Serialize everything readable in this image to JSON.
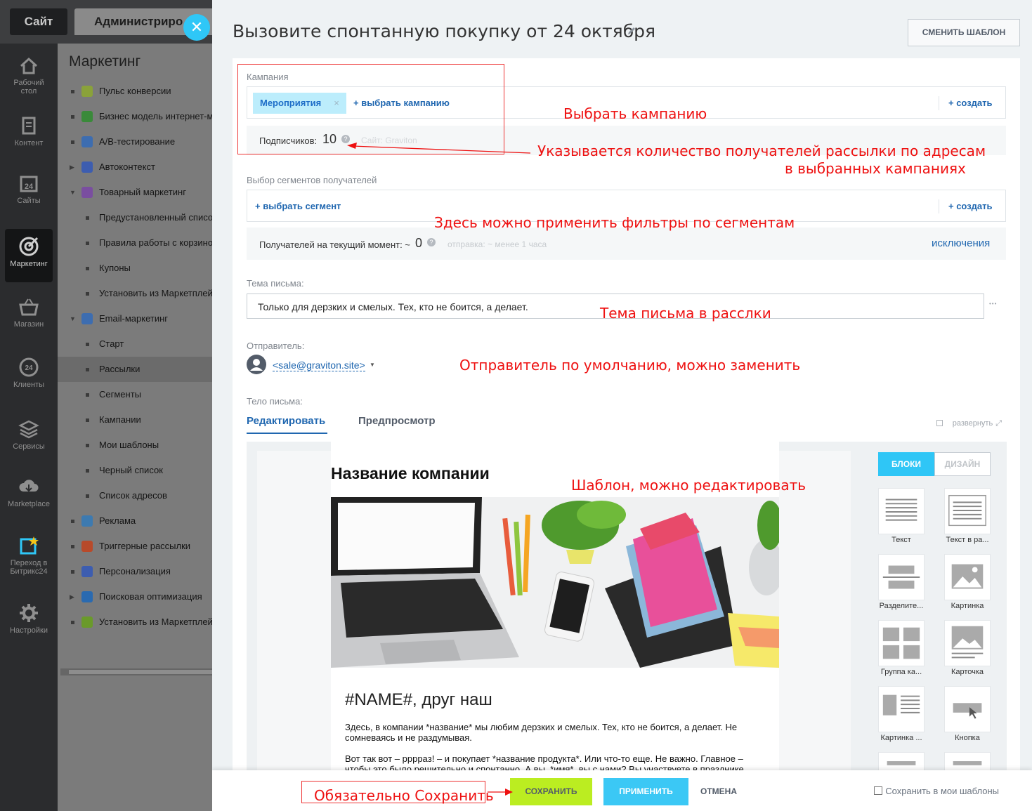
{
  "topbar": {
    "site_tab": "Сайт",
    "admin_tab": "Администриро",
    "close_glyph": "✕"
  },
  "leftbar": [
    {
      "label": "Рабочий стол",
      "icon": "home-icon"
    },
    {
      "label": "Контент",
      "icon": "document-icon"
    },
    {
      "label": "Сайты",
      "icon": "calendar-24-icon"
    },
    {
      "label": "Маркетинг",
      "icon": "target-icon"
    },
    {
      "label": "Магазин",
      "icon": "basket-icon"
    },
    {
      "label": "Клиенты",
      "icon": "clients-24-icon"
    },
    {
      "label": "Сервисы",
      "icon": "layers-icon"
    },
    {
      "label": "Marketplace",
      "icon": "cloud-download-icon"
    },
    {
      "label": "Переход в Битрикс24",
      "icon": "bitrix24-icon"
    },
    {
      "label": "Настройки",
      "icon": "gear-icon"
    }
  ],
  "menu": {
    "title": "Маркетинг",
    "items": [
      {
        "label": "Пульс конверсии",
        "icon": "funnel-icon",
        "type": "top"
      },
      {
        "label": "Бизнес модель интернет-м",
        "icon": "business-model-icon",
        "type": "top"
      },
      {
        "label": "A/B-тестирование",
        "icon": "ab-test-icon",
        "type": "top"
      },
      {
        "label": "Автоконтекст",
        "icon": "autocontext-icon",
        "type": "collapsed"
      },
      {
        "label": "Товарный маркетинг",
        "icon": "percent-icon",
        "type": "expanded"
      },
      {
        "label": "Предустановленный списо",
        "type": "sub"
      },
      {
        "label": "Правила работы с корзино",
        "type": "sub"
      },
      {
        "label": "Купоны",
        "type": "sub"
      },
      {
        "label": "Установить из Маркетплей",
        "type": "sub"
      },
      {
        "label": "Email-маркетинг",
        "icon": "email-marketing-icon",
        "type": "expanded"
      },
      {
        "label": "Старт",
        "type": "sub"
      },
      {
        "label": "Рассылки",
        "type": "sub",
        "selected": true
      },
      {
        "label": "Сегменты",
        "type": "sub"
      },
      {
        "label": "Кампании",
        "type": "sub"
      },
      {
        "label": "Мои шаблоны",
        "type": "sub"
      },
      {
        "label": "Черный список",
        "type": "sub"
      },
      {
        "label": "Список адресов",
        "type": "sub"
      },
      {
        "label": "Реклама",
        "icon": "megaphone-icon",
        "type": "top"
      },
      {
        "label": "Триггерные рассылки",
        "icon": "trigger-icon",
        "type": "top"
      },
      {
        "label": "Персонализация",
        "icon": "person-icon",
        "type": "top"
      },
      {
        "label": "Поисковая оптимизация",
        "icon": "seo-icon",
        "type": "collapsed"
      },
      {
        "label": "Установить из Маркетплей",
        "icon": "cart-icon",
        "type": "top"
      }
    ]
  },
  "header": {
    "title": "Вызовите спонтанную покупку от 24 октября",
    "change_template": "СМЕНИТЬ ШАБЛОН"
  },
  "campaign": {
    "label": "Кампания",
    "tag": "Мероприятия",
    "tag_remove": "×",
    "choose": "+ выбрать кампанию",
    "create": "+ создать",
    "subscribers_label": "Подписчиков:",
    "subscribers_count": "10",
    "site": "Сайт: Graviton"
  },
  "segments": {
    "label": "Выбор сегментов получателей",
    "choose": "+ выбрать сегмент",
    "create": "+ создать",
    "recipients_label": "Получателей на текущий момент: ~",
    "recipients_count": "0",
    "send_time": "отправка: ~ менее 1 часа",
    "exclusions": "исключения"
  },
  "subject": {
    "label": "Тема письма:",
    "value": "Только для дерзких и смелых. Тех, кто не боится, а делает.",
    "more": "•••"
  },
  "sender": {
    "label": "Отправитель:",
    "email": "<sale@graviton.site>"
  },
  "body": {
    "label": "Тело письма:",
    "tab_edit": "Редактировать",
    "tab_preview": "Предпросмотр",
    "expand": "развернуть"
  },
  "email": {
    "company": "Название компании",
    "greeting": "#NAME#, друг наш",
    "para1": "Здесь, в компании *название* мы любим дерзких и смелых. Тех, кто не боится, а делает. Не сомневаясь и не раздумывая.",
    "para2": "Вот так вот – ррррaз! – и покупает *название продукта*. Или что-то еще. Не важно. Главное – чтобы это было решительно и спонтанно. А вы, *имя*, вы с нами? Вы участвуете в празднике"
  },
  "blocks_panel": {
    "tab_blocks": "БЛОКИ",
    "tab_design": "ДИЗАЙН",
    "blocks": [
      "Текст",
      "Текст в ра...",
      "Разделите...",
      "Картинка",
      "Группа ка...",
      "Карточка",
      "Картинка ...",
      "Кнопка"
    ]
  },
  "annotations": {
    "campaign": "Выбрать кампанию",
    "count_line1": "Указывается количество получателей рассылки по адресам",
    "count_line2": "в выбранных кампаниях",
    "segments": "Здесь можно применить фильтры по сегментам",
    "subject": "Тема письма в расслки",
    "sender": "Отправитель по умолчанию, можно заменить",
    "template": "Шаблон, можно редактировать",
    "save": "Обязательно Сохранить"
  },
  "footer": {
    "save": "СОХРАНИТЬ",
    "apply": "ПРИМЕНИТЬ",
    "cancel": "ОТМЕНА",
    "save_template": "Сохранить в мои шаблоны"
  },
  "colors": {
    "accent_blue": "#2fc6f6",
    "save_green": "#bbed21",
    "annotation_red": "#ee1111",
    "link_blue": "#2067b0"
  }
}
